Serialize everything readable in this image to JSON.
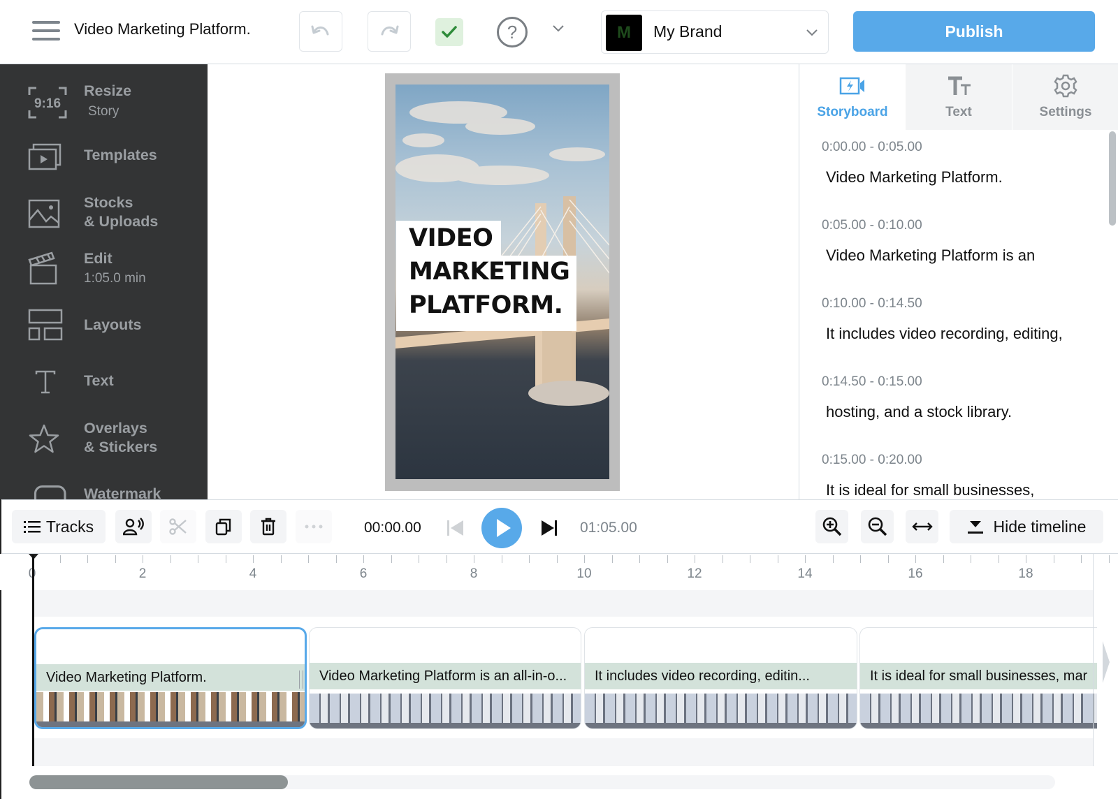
{
  "header": {
    "menu_icon": "hamburger-icon",
    "project_title": "Video Marketing Platform.",
    "undo_icon": "undo-icon",
    "redo_icon": "redo-icon",
    "save_status_icon": "check-icon",
    "help_icon": "question-icon",
    "help_symbol": "?",
    "brand": {
      "logo_letter": "M",
      "name": "My Brand"
    },
    "publish_label": "Publish"
  },
  "sidebar": {
    "items": [
      {
        "icon": "aspect-ratio-icon",
        "icon_text": "9:16",
        "label": "Resize",
        "sub": "Story"
      },
      {
        "icon": "templates-icon",
        "label": "Templates"
      },
      {
        "icon": "image-icon",
        "label": "Stocks",
        "label2": "& Uploads"
      },
      {
        "icon": "clapperboard-icon",
        "label": "Edit",
        "sub": "1:05.0 min"
      },
      {
        "icon": "layouts-icon",
        "label": "Layouts"
      },
      {
        "icon": "text-icon",
        "label": "Text"
      },
      {
        "icon": "star-icon",
        "label": "Overlays",
        "label2": "& Stickers"
      },
      {
        "icon": "watermark-icon",
        "label": "Watermark"
      }
    ]
  },
  "preview": {
    "caption": "VIDEO\nMARKETING\nPLATFORM."
  },
  "right_panel": {
    "tabs": [
      {
        "icon": "storyboard-icon",
        "label": "Storyboard",
        "active": true
      },
      {
        "icon": "text-size-icon",
        "label": "Text",
        "active": false
      },
      {
        "icon": "gear-icon",
        "label": "Settings",
        "active": false
      }
    ],
    "storyboard": [
      {
        "time": "0:00.00 - 0:05.00",
        "text": "Video Marketing Platform."
      },
      {
        "time": "0:05.00 - 0:10.00",
        "text": "Video Marketing Platform is an"
      },
      {
        "time": "0:10.00 - 0:14.50",
        "text": "It includes video recording, editing,"
      },
      {
        "time": "0:14.50 - 0:15.00",
        "text": "hosting, and a stock library."
      },
      {
        "time": "0:15.00 - 0:20.00",
        "text": "It is ideal for small businesses,"
      }
    ]
  },
  "timeline_controls": {
    "tracks_label": "Tracks",
    "current_time": "00:00.00",
    "total_time": "01:05.00",
    "hide_timeline_label": "Hide timeline"
  },
  "timeline": {
    "ruler_labels": [
      "0",
      "2",
      "4",
      "6",
      "8",
      "10",
      "12",
      "14",
      "16",
      "18"
    ],
    "scenes": [
      {
        "caption": "Video Marketing Platform.",
        "selected": true
      },
      {
        "caption": "Video Marketing Platform is an all-in-o...",
        "selected": false
      },
      {
        "caption": "It includes video recording, editin...",
        "selected": false
      },
      {
        "caption": "It is ideal for small businesses, mar",
        "selected": false
      }
    ],
    "scroll_position_fraction": 0.25
  }
}
